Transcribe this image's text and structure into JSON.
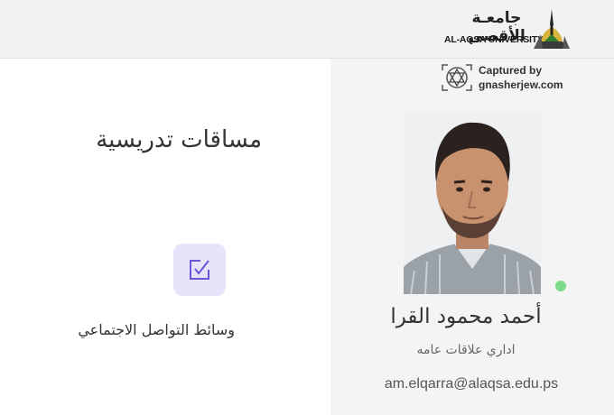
{
  "header": {
    "logo_arabic": "جامعـة الأقصى",
    "logo_english": "AL-AQSA UNIVERSITY"
  },
  "watermark": {
    "line1": "Captured by",
    "line2": "gnasherjew.com"
  },
  "left": {
    "section_title": "مساقات تدريسية",
    "social_label": "وسائط التواصل الاجتماعي",
    "check_icon": "checkbox-edit-icon"
  },
  "profile": {
    "name": "أحمد محمود القرا",
    "job_title": "اداري علاقات عامه",
    "email": "am.elqarra@alaqsa.edu.ps",
    "status": "online"
  },
  "colors": {
    "topbar": "#f2f2f2",
    "right_panel": "#f4f4f4",
    "accent_box": "#e7e3fb",
    "accent_icon": "#6b57d6",
    "status_online": "#7ddc8a"
  }
}
